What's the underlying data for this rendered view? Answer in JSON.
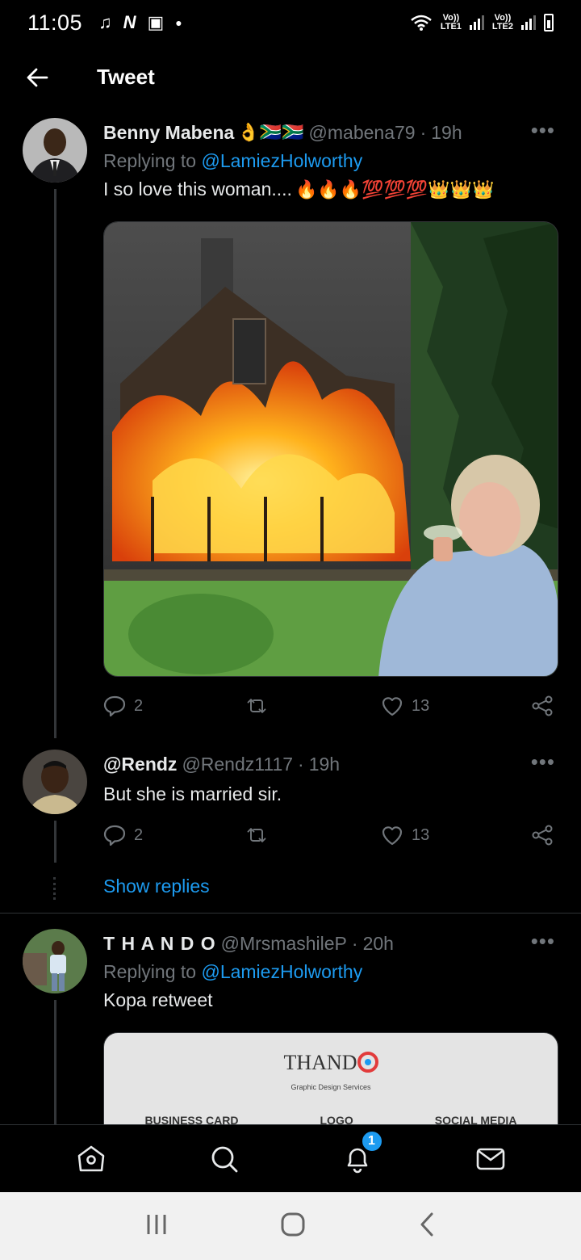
{
  "status": {
    "time": "11:05",
    "sim1": "LTE1",
    "sim2": "LTE2",
    "volte": "Vo))"
  },
  "header": {
    "title": "Tweet"
  },
  "tweets": [
    {
      "name": "Benny Mabena",
      "name_emoji": "👌🇿🇦🇿🇦",
      "handle": "@mabena79",
      "time": "19h",
      "replying_label": "Replying to",
      "replying_to": "@LamiezHolworthy",
      "text": "I so love this woman....",
      "text_emoji": "🔥🔥🔥💯💯💯👑👑👑",
      "replies": "2",
      "likes": "13"
    },
    {
      "name": "@Rendz",
      "handle": "@Rendz1117",
      "time": "19h",
      "text": "But she is married sir.",
      "replies": "2",
      "likes": "13"
    },
    {
      "name": "T H A N D O",
      "handle": "@MrsmashileP",
      "time": "20h",
      "replying_label": "Replying to",
      "replying_to": "@LamiezHolworthy",
      "text": "Kopa retweet",
      "card": {
        "brand": "THAND",
        "tagline": "Graphic Design Services",
        "items": [
          "BUSINESS CARD",
          "LOGO",
          "SOCIAL MEDIA"
        ]
      }
    }
  ],
  "show_replies": "Show replies",
  "dot_sep": "·",
  "more": "•••",
  "notification_count": "1",
  "colors": {
    "accent": "#1d9bf0",
    "muted": "#71767b",
    "background": "#000000"
  }
}
